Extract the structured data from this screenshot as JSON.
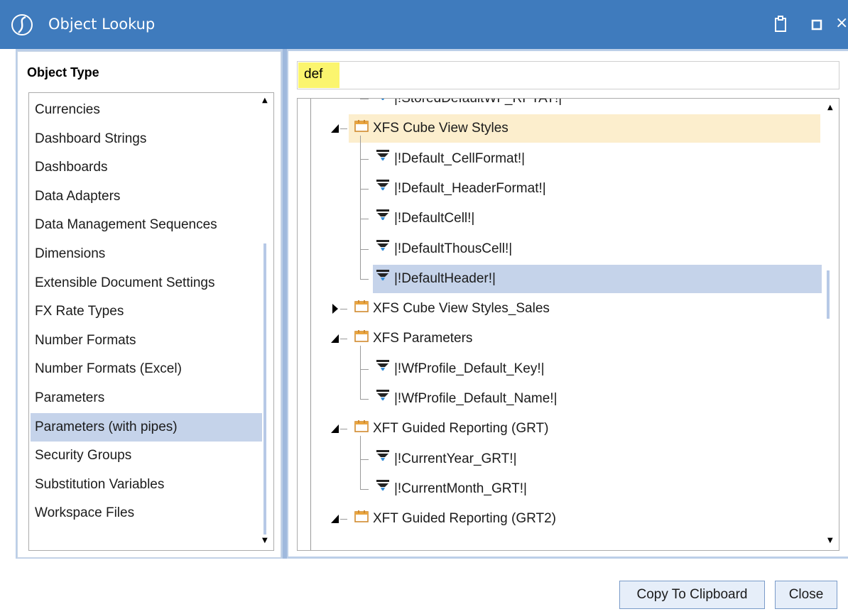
{
  "window": {
    "title": "Object Lookup"
  },
  "left_panel": {
    "header": "Object Type",
    "items": [
      {
        "label": "Currencies"
      },
      {
        "label": "Dashboard Strings"
      },
      {
        "label": "Dashboards"
      },
      {
        "label": "Data Adapters"
      },
      {
        "label": "Data Management Sequences"
      },
      {
        "label": "Dimensions"
      },
      {
        "label": "Extensible Document Settings"
      },
      {
        "label": "FX Rate Types"
      },
      {
        "label": "Number Formats"
      },
      {
        "label": "Number Formats (Excel)"
      },
      {
        "label": "Parameters"
      },
      {
        "label": "Parameters (with pipes)",
        "selected": true
      },
      {
        "label": "Security Groups"
      },
      {
        "label": "Substitution Variables"
      },
      {
        "label": "Workspace Files"
      }
    ]
  },
  "search": {
    "value": "def"
  },
  "tree": {
    "rows": [
      {
        "level": 1,
        "kind": "leaf",
        "label": "|!StoredDefaultWF_RPTAT!|",
        "partial": true
      },
      {
        "level": 0,
        "kind": "folder",
        "expanded": true,
        "label": "XFS Cube View Styles",
        "highlight": true
      },
      {
        "level": 1,
        "kind": "leaf",
        "label": "|!Default_CellFormat!|"
      },
      {
        "level": 1,
        "kind": "leaf",
        "label": "|!Default_HeaderFormat!|"
      },
      {
        "level": 1,
        "kind": "leaf",
        "label": "|!DefaultCell!|"
      },
      {
        "level": 1,
        "kind": "leaf",
        "label": "|!DefaultThousCell!|"
      },
      {
        "level": 1,
        "kind": "leaf",
        "label": "|!DefaultHeader!|",
        "selected": true
      },
      {
        "level": 0,
        "kind": "folder",
        "expanded": false,
        "label": "XFS Cube View Styles_Sales"
      },
      {
        "level": 0,
        "kind": "folder",
        "expanded": true,
        "label": "XFS Parameters"
      },
      {
        "level": 1,
        "kind": "leaf",
        "label": "|!WfProfile_Default_Key!|"
      },
      {
        "level": 1,
        "kind": "leaf",
        "label": "|!WfProfile_Default_Name!|"
      },
      {
        "level": 0,
        "kind": "folder",
        "expanded": true,
        "label": "XFT Guided Reporting (GRT)"
      },
      {
        "level": 1,
        "kind": "leaf",
        "label": "|!CurrentYear_GRT!|"
      },
      {
        "level": 1,
        "kind": "leaf",
        "label": "|!CurrentMonth_GRT!|"
      },
      {
        "level": 0,
        "kind": "folder",
        "expanded": true,
        "label": "XFT Guided Reporting (GRT2)"
      }
    ]
  },
  "buttons": {
    "copy_label": "Copy To Clipboard",
    "close_label": "Close"
  },
  "colors": {
    "titlebar": "#3f7bbd",
    "selection": "#c5d3ea",
    "folder_highlight": "#fceecd",
    "search_highlight": "#fbf56e"
  }
}
